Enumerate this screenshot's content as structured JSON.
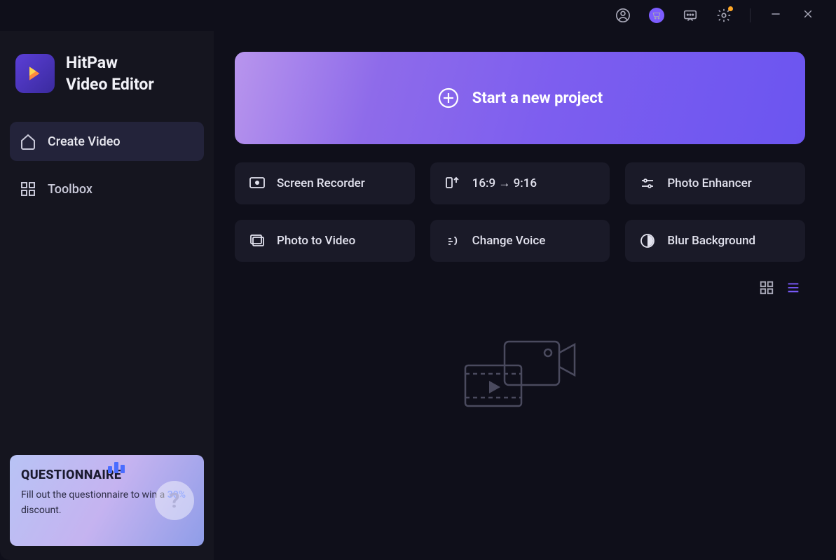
{
  "app": {
    "name_line1": "HitPaw",
    "name_line2": "Video Editor"
  },
  "nav": {
    "create_video": "Create Video",
    "toolbox": "Toolbox"
  },
  "hero": {
    "label": "Start a new project"
  },
  "tools": {
    "screen_recorder": "Screen Recorder",
    "aspect_ratio": "16:9 → 9:16",
    "photo_enhancer": "Photo Enhancer",
    "photo_to_video": "Photo to Video",
    "change_voice": "Change Voice",
    "blur_background": "Blur Background"
  },
  "promo": {
    "title": "QUESTIONNAIRE",
    "desc_prefix": "Fill out the questionnaire to win a ",
    "discount": "30%",
    "desc_suffix": " discount."
  }
}
